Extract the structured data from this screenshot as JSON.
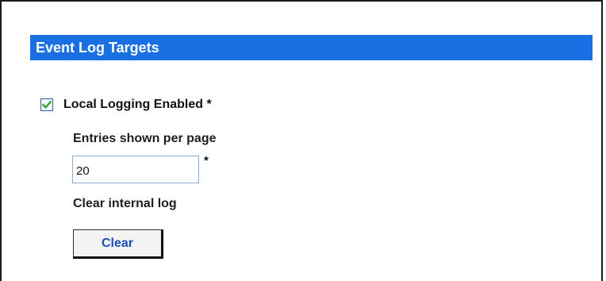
{
  "section": {
    "title": "Event Log Targets"
  },
  "local_logging": {
    "label": "Local Logging Enabled *",
    "checked": true
  },
  "entries_per_page": {
    "label": "Entries shown per page",
    "value": "20",
    "required_marker": "*"
  },
  "clear_log": {
    "label": "Clear internal log",
    "button_label": "Clear"
  },
  "colors": {
    "header_background": "#1a6fe3",
    "header_text": "#ffffff",
    "button_text": "#1a4fb4",
    "checkmark": "#2aa52a"
  },
  "icons": {
    "checkbox": "checkmark-icon"
  }
}
